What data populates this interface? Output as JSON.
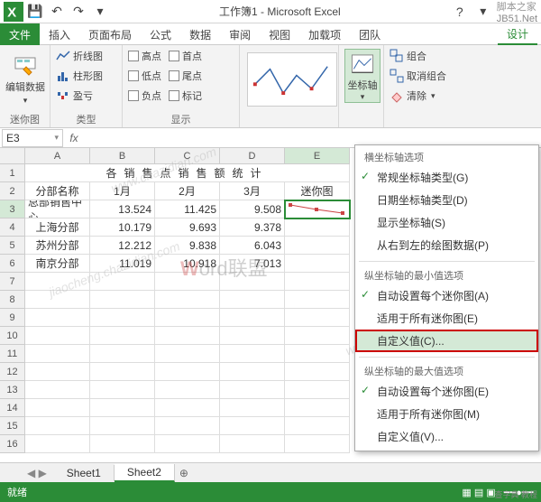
{
  "app": {
    "title": "工作簿1 - Microsoft Excel",
    "brand": "脚本之家",
    "brand_url": "JB51.Net"
  },
  "tabs": {
    "file": "文件",
    "insert": "插入",
    "pagelayout": "页面布局",
    "formulas": "公式",
    "data": "数据",
    "review": "审阅",
    "view": "视图",
    "addins": "加载项",
    "team": "团队",
    "design": "设计"
  },
  "ribbon": {
    "editdata": "编辑数据",
    "sparkline_group": "迷你图",
    "line": "折线图",
    "column": "柱形图",
    "winloss": "盈亏",
    "type_group": "类型",
    "high": "高点",
    "low": "低点",
    "neg": "负点",
    "first": "首点",
    "last": "尾点",
    "markers": "标记",
    "show_group": "显示",
    "axis": "坐标轴",
    "group": "组合",
    "ungroup": "取消组合",
    "clear": "清除"
  },
  "namebox": "E3",
  "headers": [
    "A",
    "B",
    "C",
    "D",
    "E"
  ],
  "cells": {
    "title": "各销售点销售额统计",
    "h0": "分部名称",
    "h1": "1月",
    "h2": "2月",
    "h3": "3月",
    "h4": "迷你图",
    "r1c0": "总部销售中心",
    "r1c1": "13.524",
    "r1c2": "11.425",
    "r1c3": "9.508",
    "r2c0": "上海分部",
    "r2c1": "10.179",
    "r2c2": "9.693",
    "r2c3": "9.378",
    "r3c0": "苏州分部",
    "r3c1": "12.212",
    "r3c2": "9.838",
    "r3c3": "6.043",
    "r4c0": "南京分部",
    "r4c1": "11.019",
    "r4c2": "10.918",
    "r4c3": "7.013"
  },
  "dropdown": {
    "horiz_header": "横坐标轴选项",
    "h1": "常规坐标轴类型(G)",
    "h2": "日期坐标轴类型(D)",
    "h3": "显示坐标轴(S)",
    "h4": "从右到左的绘图数据(P)",
    "min_header": "纵坐标轴的最小值选项",
    "m1": "自动设置每个迷你图(A)",
    "m2": "适用于所有迷你图(E)",
    "m3": "自定义值(C)...",
    "max_header": "纵坐标轴的最大值选项",
    "x1": "自动设置每个迷你图(E)",
    "x2": "适用于所有迷你图(M)",
    "x3": "自定义值(V)..."
  },
  "sheets": {
    "s1": "Sheet1",
    "s2": "Sheet2"
  },
  "status": {
    "ready": "就绪"
  },
  "chart_data": {
    "type": "line",
    "location": "sparkline in E3",
    "x": [
      "1月",
      "2月",
      "3月"
    ],
    "series": [
      {
        "name": "总部销售中心",
        "values": [
          13.524,
          11.425,
          9.508
        ]
      },
      {
        "name": "上海分部",
        "values": [
          10.179,
          9.693,
          9.378
        ]
      },
      {
        "name": "苏州分部",
        "values": [
          12.212,
          9.838,
          6.043
        ]
      },
      {
        "name": "南京分部",
        "values": [
          11.019,
          10.918,
          7.013
        ]
      }
    ]
  }
}
